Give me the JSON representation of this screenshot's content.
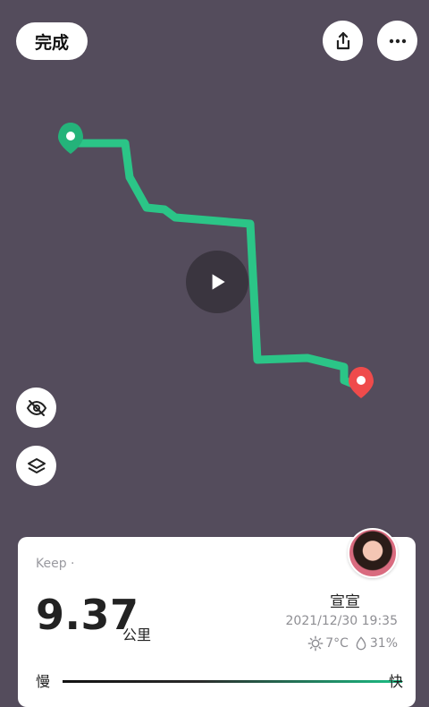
{
  "status_bar": {
    "time": "",
    "signal": "",
    "battery": ""
  },
  "toolbar": {
    "done_label": "完成",
    "share_icon": "share-icon",
    "more_icon": "more-icon"
  },
  "map": {
    "route_color": "#2bc587",
    "start_marker_color": "#24b37a",
    "end_marker_color": "#ef4b4b",
    "play_icon": "play-icon",
    "hide_icon": "eye-off-icon",
    "layers_icon": "layers-icon"
  },
  "summary": {
    "brand": "Keep ·",
    "distance": "9.37",
    "unit": "公里",
    "user": "宣宣",
    "datetime": "2021/12/30 19:35",
    "temperature": "7°C",
    "humidity": "31%",
    "speed_slow": "慢",
    "speed_fast": "快"
  }
}
